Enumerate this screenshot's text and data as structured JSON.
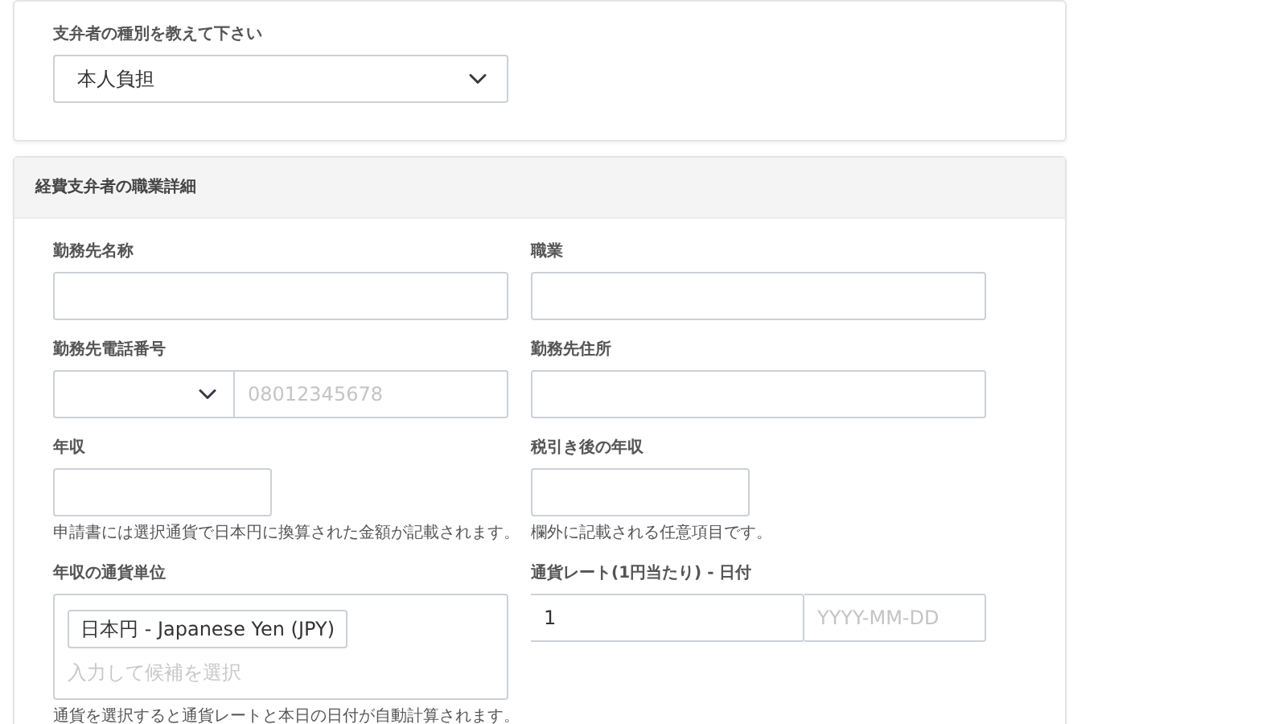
{
  "payer_type": {
    "label": "支弁者の種別を教えて下さい",
    "value": "本人負担"
  },
  "occupation_section": {
    "title": "経費支弁者の職業詳細",
    "fields": [
      {
        "kind": "text",
        "label": "勤務先名称"
      },
      {
        "kind": "text",
        "label": "職業"
      },
      {
        "kind": "phone",
        "label": "勤務先電話番号",
        "placeholder": "08012345678"
      },
      {
        "kind": "text",
        "label": "勤務先住所"
      },
      {
        "kind": "short_text",
        "label": "年収",
        "help": "申請書には選択通貨で日本円に換算された金額が記載されます。"
      },
      {
        "kind": "short_text",
        "label": "税引き後の年収",
        "help": "欄外に記載される任意項目です。"
      },
      {
        "kind": "currency",
        "label": "年収の通貨単位",
        "tag": "日本円 - Japanese Yen (JPY)",
        "placeholder": "入力して候補を選択",
        "help": "通貨を選択すると通貨レートと本日の日付が自動計算されます。"
      },
      {
        "kind": "rate_date",
        "label": "通貨レート(1円当たり) - 日付",
        "value": "1",
        "placeholder": "YYYY-MM-DD"
      }
    ]
  }
}
